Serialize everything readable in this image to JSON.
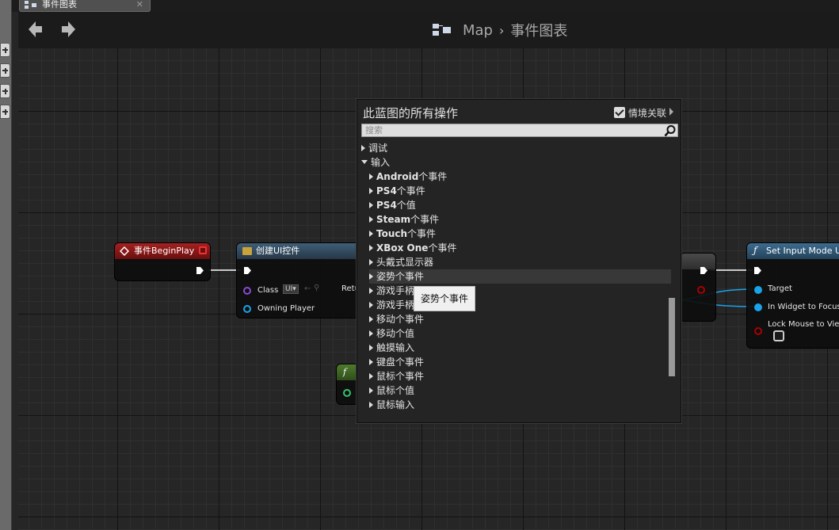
{
  "tab": {
    "label": "事件图表",
    "close": "✕"
  },
  "breadcrumb": {
    "root": "Map",
    "separator": "›",
    "current": "事件图表"
  },
  "nodes": {
    "begin_play": {
      "title": "事件BeginPlay",
      "color": "#8a1a1a"
    },
    "create_widget": {
      "title": "创建UI控件",
      "class_label": "Class",
      "class_value": "UI▾",
      "owning_player": "Owning Player",
      "return_label": "Retu"
    },
    "set_input_mode": {
      "title": "Set Input Mode UI",
      "target": "Target",
      "in_widget": "In Widget to Focus",
      "lock_mouse": "Lock Mouse to View"
    },
    "func_node": {
      "icon": "f"
    }
  },
  "popup": {
    "title": "此蓝图的所有操作",
    "context_label": "情境关联",
    "context_checked": true,
    "search_placeholder": "搜索",
    "items": [
      {
        "label": "调试",
        "expanded": false,
        "indent": 0
      },
      {
        "label": "输入",
        "expanded": true,
        "indent": 0
      },
      {
        "bold": "Android",
        "label": "个事件",
        "indent": 1
      },
      {
        "bold": "PS4",
        "label": "个事件",
        "indent": 1
      },
      {
        "bold": "PS4",
        "label": "个值",
        "indent": 1
      },
      {
        "bold": "Steam",
        "label": "个事件",
        "indent": 1
      },
      {
        "bold": "Touch",
        "label": "个事件",
        "indent": 1
      },
      {
        "bold": "XBox One",
        "label": "个事件",
        "indent": 1
      },
      {
        "label": "头戴式显示器",
        "indent": 1
      },
      {
        "label": "姿势个事件",
        "indent": 1,
        "hover": true
      },
      {
        "label": "游戏手柄",
        "indent": 1
      },
      {
        "label": "游戏手柄",
        "indent": 1
      },
      {
        "label": "移动个事件",
        "indent": 1
      },
      {
        "label": "移动个值",
        "indent": 1
      },
      {
        "label": "触摸输入",
        "indent": 1
      },
      {
        "label": "键盘个事件",
        "indent": 1
      },
      {
        "label": "鼠标个事件",
        "indent": 1
      },
      {
        "label": "鼠标个值",
        "indent": 1
      },
      {
        "label": "鼠标输入",
        "indent": 1
      }
    ],
    "tooltip": "姿势个事件"
  },
  "colors": {
    "graph_bg": "#262626",
    "exec": "#ffffff",
    "object_pin": "#1aa3e8",
    "bool_pin": "#a00000"
  }
}
